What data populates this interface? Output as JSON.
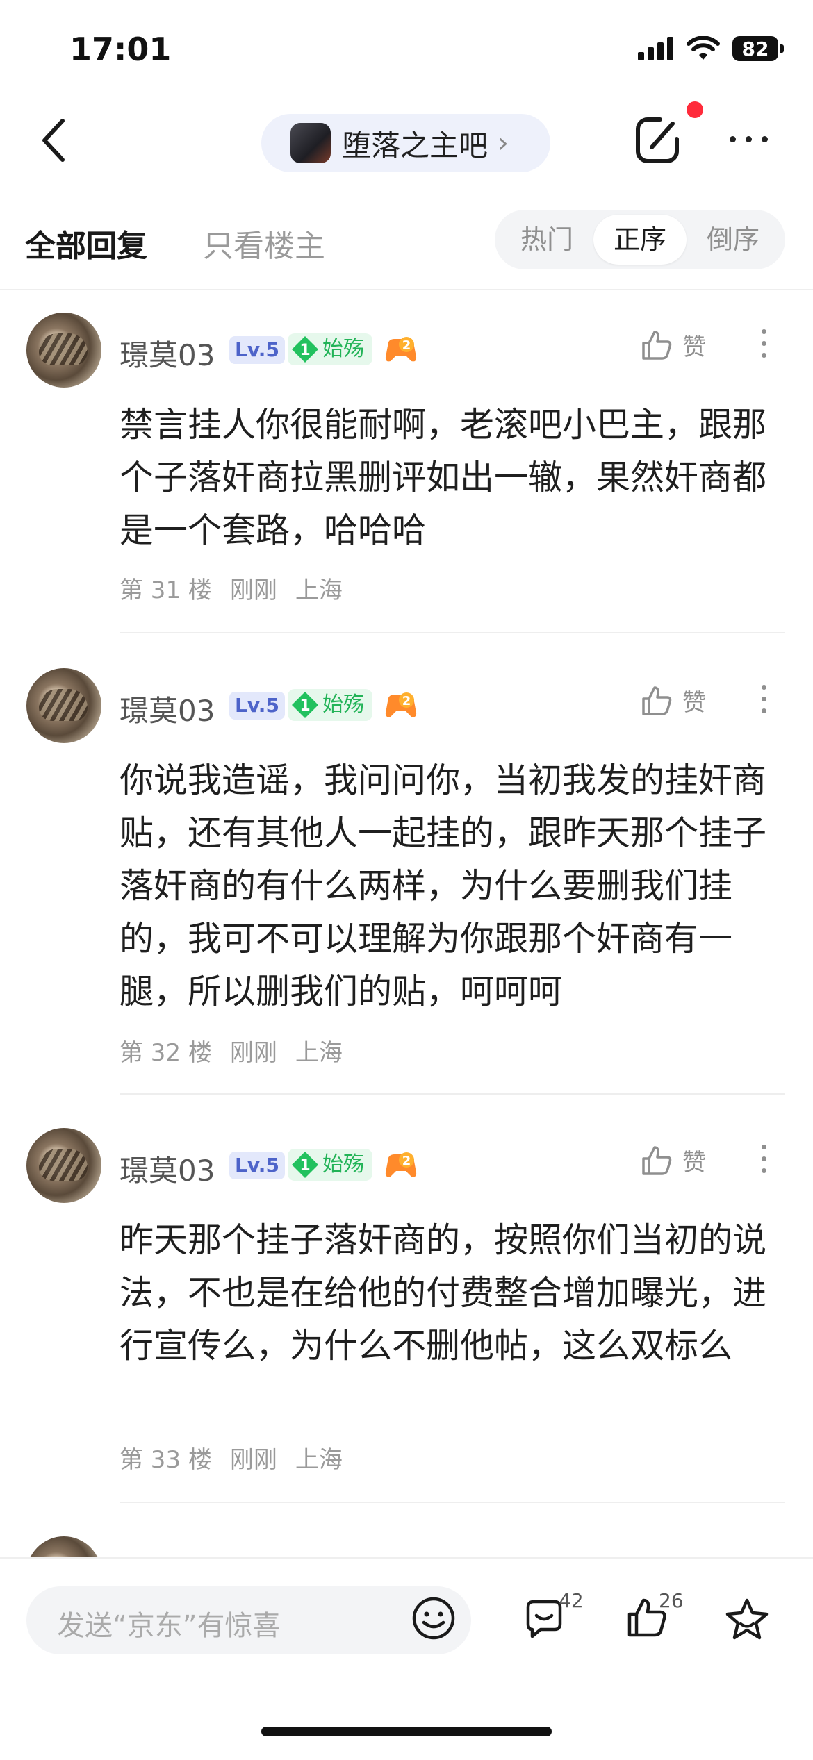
{
  "status_bar": {
    "time": "17:01",
    "battery": "82"
  },
  "nav": {
    "forum_name": "堕落之主吧"
  },
  "tabs": {
    "all_replies": "全部回复",
    "owner_only": "只看楼主"
  },
  "sort": {
    "hot": "热门",
    "asc": "正序",
    "desc": "倒序",
    "active": "正序"
  },
  "posts": [
    {
      "username": "璟莫03",
      "level": "Lv.5",
      "rank_num": "1",
      "title": "始殇",
      "game_num": "2",
      "like_label": "赞",
      "content": "禁言挂人你很能耐啊，老滚吧小巴主，跟那个子落奸商拉黑删评如出一辙，果然奸商都是一个套路，哈哈哈",
      "floor": "第 31 楼",
      "time": "刚刚",
      "location": "上海"
    },
    {
      "username": "璟莫03",
      "level": "Lv.5",
      "rank_num": "1",
      "title": "始殇",
      "game_num": "2",
      "like_label": "赞",
      "content": "你说我造谣，我问问你，当初我发的挂奸商贴，还有其他人一起挂的，跟昨天那个挂子落奸商的有什么两样，为什么要删我们挂的，我可不可以理解为你跟那个奸商有一腿，所以删我们的贴，呵呵呵",
      "floor": "第 32 楼",
      "time": "刚刚",
      "location": "上海"
    },
    {
      "username": "璟莫03",
      "level": "Lv.5",
      "rank_num": "1",
      "title": "始殇",
      "game_num": "2",
      "like_label": "赞",
      "content": "昨天那个挂子落奸商的，按照你们当初的说法，不也是在给他的付费整合增加曝光，进行宣传么，为什么不删他帖，这么双标么",
      "floor": "第 33 楼",
      "time": "刚刚",
      "location": "上海"
    }
  ],
  "bottom": {
    "input_placeholder": "发送“京东”有惊喜",
    "comment_count": "42",
    "like_count": "26"
  },
  "colors": {
    "accent_green": "#22b357",
    "level_blue": "#4d63c9",
    "notify_red": "#ff2b3b"
  }
}
